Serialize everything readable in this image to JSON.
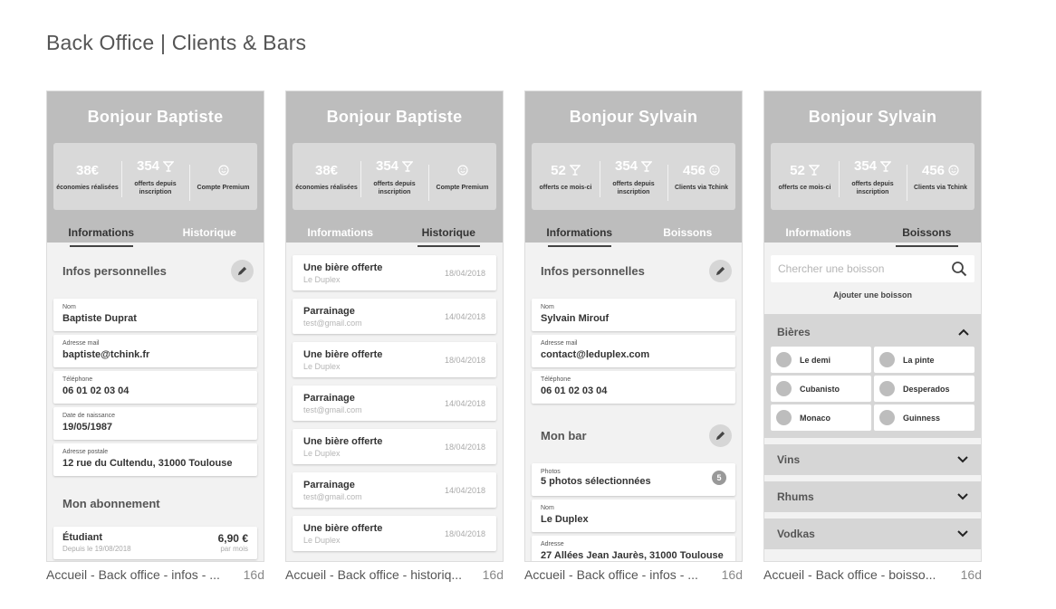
{
  "page": {
    "title": "Back Office | Clients & Bars"
  },
  "colors": {
    "header_bg": "#bdbdbd",
    "stats_bg": "#d9d9d9",
    "screen_bg": "#f2f2f2",
    "category_bg": "#d6d6d6"
  },
  "artboards": [
    {
      "greeting": "Bonjour Baptiste",
      "stats": [
        {
          "value": "38€",
          "icon": "",
          "label": "économies réalisées"
        },
        {
          "value": "354",
          "icon": "cocktail-glass-icon",
          "label": "offerts depuis inscription"
        },
        {
          "value": "",
          "icon": "smiley-icon",
          "label": "Compte Premium"
        }
      ],
      "tabs": [
        "Informations",
        "Historique"
      ],
      "personal_title": "Infos personnelles",
      "fields": [
        {
          "label": "Nom",
          "value": "Baptiste Duprat"
        },
        {
          "label": "Adresse mail",
          "value": "baptiste@tchink.fr"
        },
        {
          "label": "Téléphone",
          "value": "06 01 02 03 04"
        },
        {
          "label": "Date de naissance",
          "value": "19/05/1987"
        },
        {
          "label": "Adresse postale",
          "value": "12 rue du Cultendu, 31000 Toulouse"
        }
      ],
      "subscription_title": "Mon abonnement",
      "subscription": {
        "name": "Étudiant",
        "since": "Depuis le 19/08/2018",
        "price": "6,90 €",
        "period": "par mois"
      },
      "caption": {
        "name": "Accueil - Back office - infos - ...",
        "age": "16d"
      }
    },
    {
      "greeting": "Bonjour Baptiste",
      "stats": [
        {
          "value": "38€",
          "icon": "",
          "label": "économies réalisées"
        },
        {
          "value": "354",
          "icon": "cocktail-glass-icon",
          "label": "offerts depuis inscription"
        },
        {
          "value": "",
          "icon": "smiley-icon",
          "label": "Compte Premium"
        }
      ],
      "tabs": [
        "Informations",
        "Historique"
      ],
      "history": [
        {
          "title": "Une bière offerte",
          "subtitle": "Le Duplex",
          "date": "18/04/2018"
        },
        {
          "title": "Parrainage",
          "subtitle": "test@gmail.com",
          "date": "14/04/2018"
        },
        {
          "title": "Une bière offerte",
          "subtitle": "Le Duplex",
          "date": "18/04/2018"
        },
        {
          "title": "Parrainage",
          "subtitle": "test@gmail.com",
          "date": "14/04/2018"
        },
        {
          "title": "Une bière offerte",
          "subtitle": "Le Duplex",
          "date": "18/04/2018"
        },
        {
          "title": "Parrainage",
          "subtitle": "test@gmail.com",
          "date": "14/04/2018"
        },
        {
          "title": "Une bière offerte",
          "subtitle": "Le Duplex",
          "date": "18/04/2018"
        }
      ],
      "caption": {
        "name": "Accueil - Back office - historiq...",
        "age": "16d"
      }
    },
    {
      "greeting": "Bonjour Sylvain",
      "stats": [
        {
          "value": "52",
          "icon": "cocktail-glass-icon",
          "label": "offerts ce mois-ci"
        },
        {
          "value": "354",
          "icon": "cocktail-glass-icon",
          "label": "offerts depuis inscription"
        },
        {
          "value": "456",
          "icon": "smiley-icon",
          "label": "Clients via Tchink"
        }
      ],
      "tabs": [
        "Informations",
        "Boissons"
      ],
      "personal_title": "Infos personnelles",
      "fields": [
        {
          "label": "Nom",
          "value": "Sylvain Mirouf"
        },
        {
          "label": "Adresse mail",
          "value": "contact@leduplex.com"
        },
        {
          "label": "Téléphone",
          "value": "06 01 02 03 04"
        }
      ],
      "bar_title": "Mon bar",
      "bar_fields": [
        {
          "label": "Photos",
          "value": "5 photos sélectionnées",
          "badge": "5"
        },
        {
          "label": "Nom",
          "value": "Le Duplex"
        },
        {
          "label": "Adresse",
          "value": "27 Allées Jean Jaurès, 31000 Toulouse"
        }
      ],
      "caption": {
        "name": "Accueil - Back office - infos - ...",
        "age": "16d"
      }
    },
    {
      "greeting": "Bonjour Sylvain",
      "stats": [
        {
          "value": "52",
          "icon": "cocktail-glass-icon",
          "label": "offerts ce mois-ci"
        },
        {
          "value": "354",
          "icon": "cocktail-glass-icon",
          "label": "offerts depuis inscription"
        },
        {
          "value": "456",
          "icon": "smiley-icon",
          "label": "Clients via Tchink"
        }
      ],
      "tabs": [
        "Informations",
        "Boissons"
      ],
      "search_placeholder": "Chercher une boisson",
      "add_label": "Ajouter une boisson",
      "open_category": {
        "name": "Bières",
        "drinks": [
          "Le demi",
          "La pinte",
          "Cubanisto",
          "Desperados",
          "Monaco",
          "Guinness"
        ]
      },
      "closed_categories": [
        "Vins",
        "Rhums",
        "Vodkas"
      ],
      "caption": {
        "name": "Accueil - Back office - boisso...",
        "age": "16d"
      }
    }
  ]
}
